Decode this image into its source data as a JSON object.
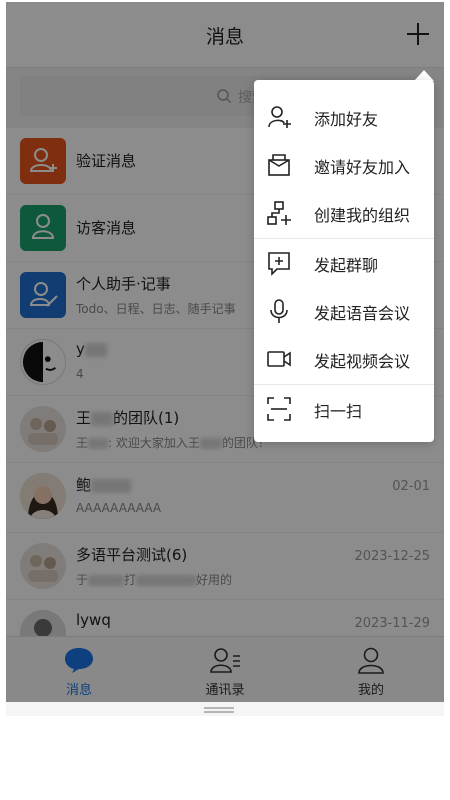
{
  "header": {
    "title": "消息"
  },
  "search": {
    "placeholder": "搜索"
  },
  "conversations": [
    {
      "title": "验证消息",
      "subtitle": "",
      "time": "",
      "avatar": "verify-icon"
    },
    {
      "title": "访客消息",
      "subtitle": "",
      "time": "",
      "avatar": "visitor-icon"
    },
    {
      "title": "个人助手·记事",
      "subtitle": "Todo、日程、日志、随手记事",
      "time": "",
      "avatar": "assistant-icon"
    },
    {
      "title": "y",
      "subtitle": "4",
      "time": "",
      "avatar": "person-avatar"
    },
    {
      "title_a": "王",
      "title_b": "的团队(1)",
      "subtitle_a": "王",
      "subtitle_b": ": 欢迎大家加入王",
      "subtitle_c": "的团队！",
      "time": "",
      "avatar": "group-avatar"
    },
    {
      "title": "鲍",
      "subtitle": "AAAAAAAAAA",
      "time": "02-01",
      "avatar": "person-avatar"
    },
    {
      "title": "多语平台测试(6)",
      "subtitle_a": "于",
      "subtitle_b": "打",
      "subtitle_c": "好用的",
      "time": "2023-12-25",
      "avatar": "group-avatar"
    },
    {
      "title": "lywq",
      "subtitle": "",
      "time": "2023-11-29",
      "avatar": "person-avatar"
    }
  ],
  "tabs": [
    {
      "label": "消息",
      "icon": "chat-bubble-icon",
      "active": true
    },
    {
      "label": "通讯录",
      "icon": "contacts-icon",
      "active": false
    },
    {
      "label": "我的",
      "icon": "profile-icon",
      "active": false
    }
  ],
  "menu": {
    "items": [
      {
        "label": "添加好友",
        "icon": "add-friend-icon"
      },
      {
        "label": "邀请好友加入",
        "icon": "invite-mail-icon"
      },
      {
        "label": "创建我的组织",
        "icon": "create-org-icon"
      },
      {
        "label": "发起群聊",
        "icon": "group-chat-icon"
      },
      {
        "label": "发起语音会议",
        "icon": "microphone-icon"
      },
      {
        "label": "发起视频会议",
        "icon": "video-camera-icon"
      },
      {
        "label": "扫一扫",
        "icon": "scan-icon"
      }
    ]
  },
  "colors": {
    "accent": "#1a73e8",
    "verify": "#e8541c",
    "visitor": "#1aa06d",
    "assistant": "#1f6fd1"
  }
}
